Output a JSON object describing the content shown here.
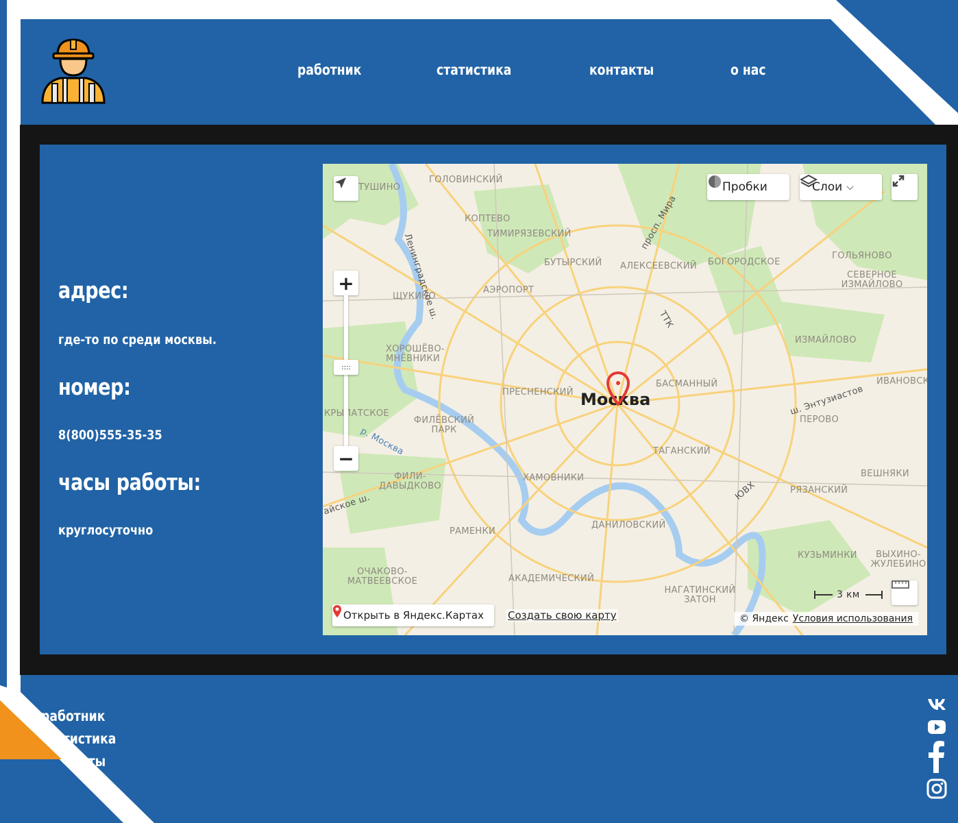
{
  "nav": {
    "items": [
      {
        "label": "работник"
      },
      {
        "label": "статистика"
      },
      {
        "label": "контакты"
      },
      {
        "label": "о нас"
      }
    ]
  },
  "logo": {
    "icon": "worker-helmet-icon"
  },
  "contact": {
    "address_heading": "адрес:",
    "address_text": "где-то по среди москвы.",
    "phone_heading": "номер:",
    "phone_text": "8(800)555-35-35",
    "hours_heading": "часы работы:",
    "hours_text": "круглосуточно"
  },
  "map": {
    "traffic_label": "Пробки",
    "layers_label": "Слои",
    "city_label": "Москва",
    "scale_label": "3 км",
    "open_in_yandex": "Открыть в Яндекс.Картах",
    "create_map": "Создать свою карту",
    "copyright": "© Яндекс",
    "terms": "Условия использования",
    "districts": [
      "ГОЛОВИНСКИЙ",
      "ТУШИНО",
      "КОПТЕВО",
      "ТИМИРЯЗЕВСКИЙ",
      "БУТЫРСКИЙ",
      "АЛЕКСЕЕВСКИЙ",
      "БОГОРОДСКОЕ",
      "ГОЛЬЯНОВО",
      "СЕВЕРНОЕ ИЗМАЙЛОВО",
      "АЭРОПОРТ",
      "ЩУКИНО",
      "ИЗМАЙЛОВО",
      "ХОРОШЁВО-МНЁВНИКИ",
      "ПРЕСНЕНСКИЙ",
      "БАСМАННЫЙ",
      "ИВАНОВСКОЕ",
      "ПЕРОВО",
      "КРЫЛАТСКОЕ",
      "ФИЛЁВСКИЙ ПАРК",
      "ТАГАНСКИЙ",
      "ВЕШНЯКИ",
      "ФИЛИ-ДАВЫДКОВО",
      "ХАМОВНИКИ",
      "РЯЗАНСКИЙ",
      "РАМЕНКИ",
      "ДАНИЛОВСКИЙ",
      "КУЗЬМИНКИ",
      "ВЫХИНО-ЖУЛЕБИНО",
      "ОЧАКОВО-МАТВЕЕВСКОЕ",
      "АКАДЕМИЧЕСКИЙ",
      "НАГАТИНСКИЙ ЗАТОН"
    ],
    "roads": [
      "Ленинградское ш.",
      "просп. Мира",
      "ТТК",
      "р. Москва",
      "ш. Энтузиастов",
      "ЮВХ",
      "айское ш."
    ]
  },
  "footer": {
    "links": [
      {
        "label": "работник"
      },
      {
        "label": "статистика"
      },
      {
        "label": "контакты"
      }
    ],
    "social": [
      "vk-icon",
      "youtube-icon",
      "facebook-icon",
      "instagram-icon"
    ]
  },
  "colors": {
    "primary_blue": "#2163a6",
    "accent_orange": "#f0921c",
    "dark_band": "#151515",
    "white": "#ffffff"
  }
}
